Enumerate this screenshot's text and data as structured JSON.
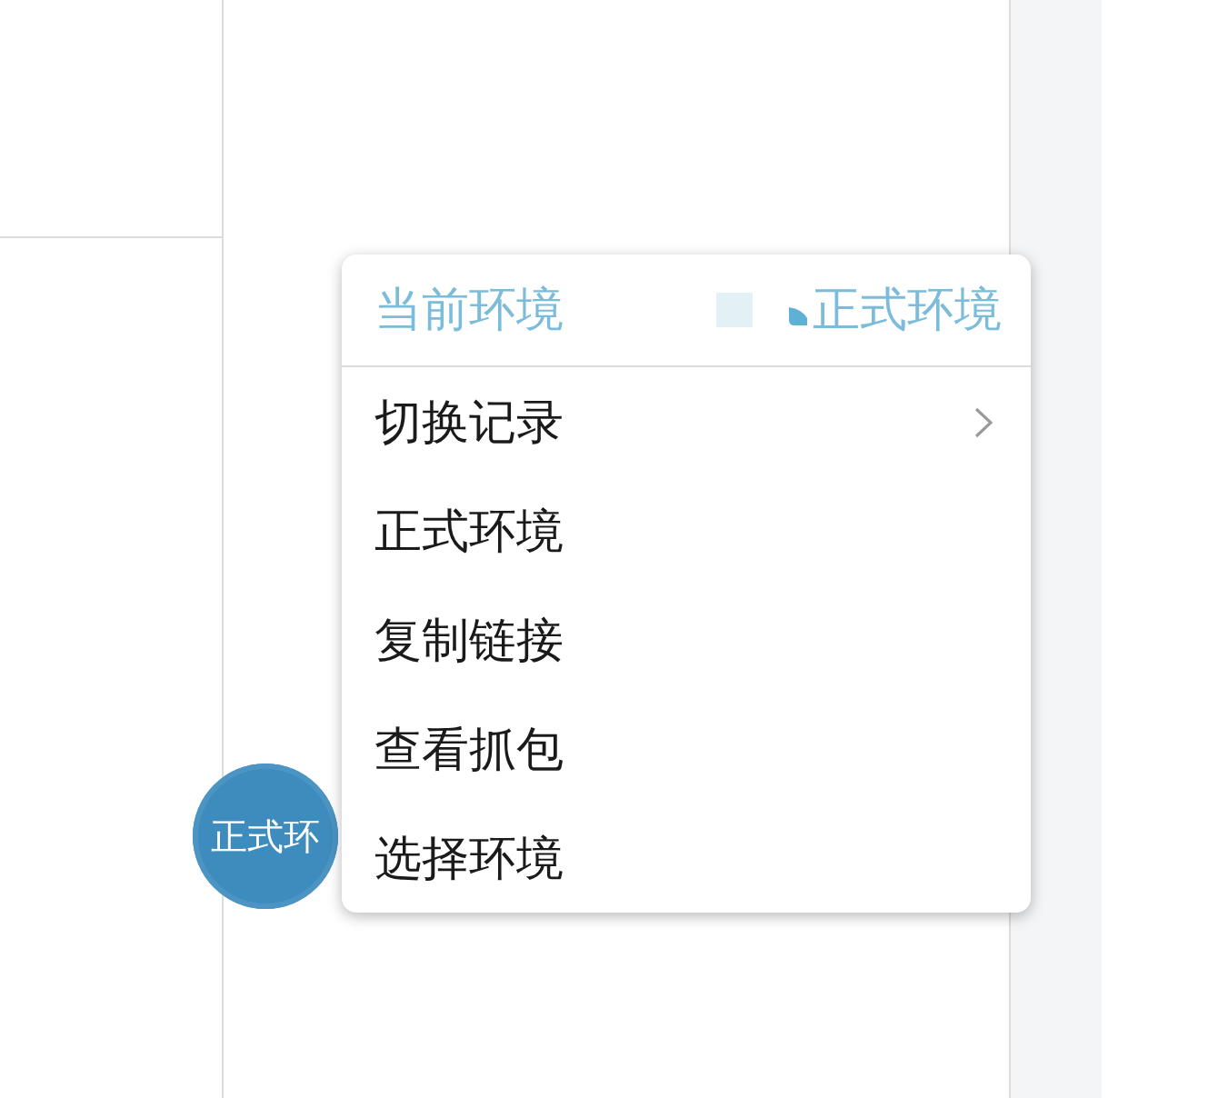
{
  "floating_button": {
    "label": "正式环"
  },
  "menu": {
    "header": {
      "label": "当前环境",
      "value": "正式环境"
    },
    "items": [
      {
        "label": "切换记录",
        "kind": "submenu"
      },
      {
        "label": "正式环境",
        "kind": "action"
      },
      {
        "label": "复制链接",
        "kind": "action"
      },
      {
        "label": "查看抓包",
        "kind": "action"
      },
      {
        "label": "选择环境",
        "kind": "action"
      }
    ]
  }
}
